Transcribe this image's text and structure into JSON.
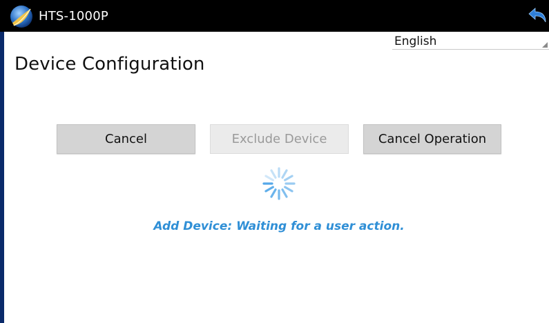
{
  "app": {
    "title": "HTS-1000P",
    "logo_icon": "moon-globe-logo",
    "back_icon": "back-arrow-icon"
  },
  "language": {
    "selected": "English"
  },
  "page": {
    "title": "Device Configuration"
  },
  "buttons": {
    "cancel": "Cancel",
    "exclude_device": "Exclude Device",
    "cancel_operation": "Cancel Operation"
  },
  "status": {
    "message": "Add Device: Waiting for a user action.",
    "color": "#2f8fd6"
  },
  "colors": {
    "titlebar": "#000000",
    "spinner": "#4aa3e8",
    "button_bg": "#d4d4d4",
    "button_disabled_bg": "#ebebeb"
  }
}
